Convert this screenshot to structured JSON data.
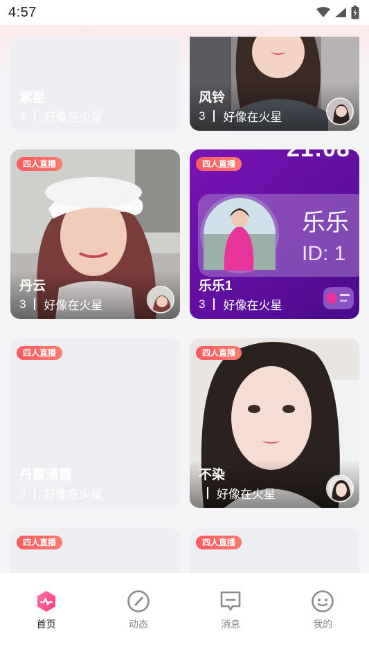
{
  "status_bar": {
    "time": "4:57"
  },
  "cards": [
    {
      "name": "紫星",
      "count": "4",
      "location": "好像在火星",
      "badge": ""
    },
    {
      "name": "风铃",
      "count": "3",
      "location": "好像在火星",
      "badge": ""
    },
    {
      "name": "丹云",
      "count": "3",
      "location": "好像在火星",
      "badge": "四人直播"
    },
    {
      "name": "乐乐1",
      "count": "3",
      "location": "好像在火星",
      "badge": "四人直播",
      "cover_title": "乐乐",
      "cover_id": "ID: 1",
      "cover_clock": "21:08"
    },
    {
      "name": "丹霞清露",
      "count": "3",
      "location": "好像在火星",
      "badge": "四人直播"
    },
    {
      "name": "不染",
      "count": "",
      "location": "好像在火星",
      "badge": "四人直播"
    },
    {
      "name": "",
      "count": "",
      "location": "",
      "badge": "四人直播"
    },
    {
      "name": "",
      "count": "",
      "location": "",
      "badge": "四人直播"
    }
  ],
  "bottom_nav": {
    "items": [
      {
        "label": "首页",
        "icon": "home-live-icon",
        "active": true
      },
      {
        "label": "动态",
        "icon": "gauge-icon",
        "active": false
      },
      {
        "label": "消息",
        "icon": "message-icon",
        "active": false
      },
      {
        "label": "我的",
        "icon": "smiley-icon",
        "active": false
      }
    ]
  },
  "colors": {
    "badge": "#ff5a5f",
    "nav_active": "#ff4f8b",
    "card_placeholder": "#eeeef2"
  }
}
